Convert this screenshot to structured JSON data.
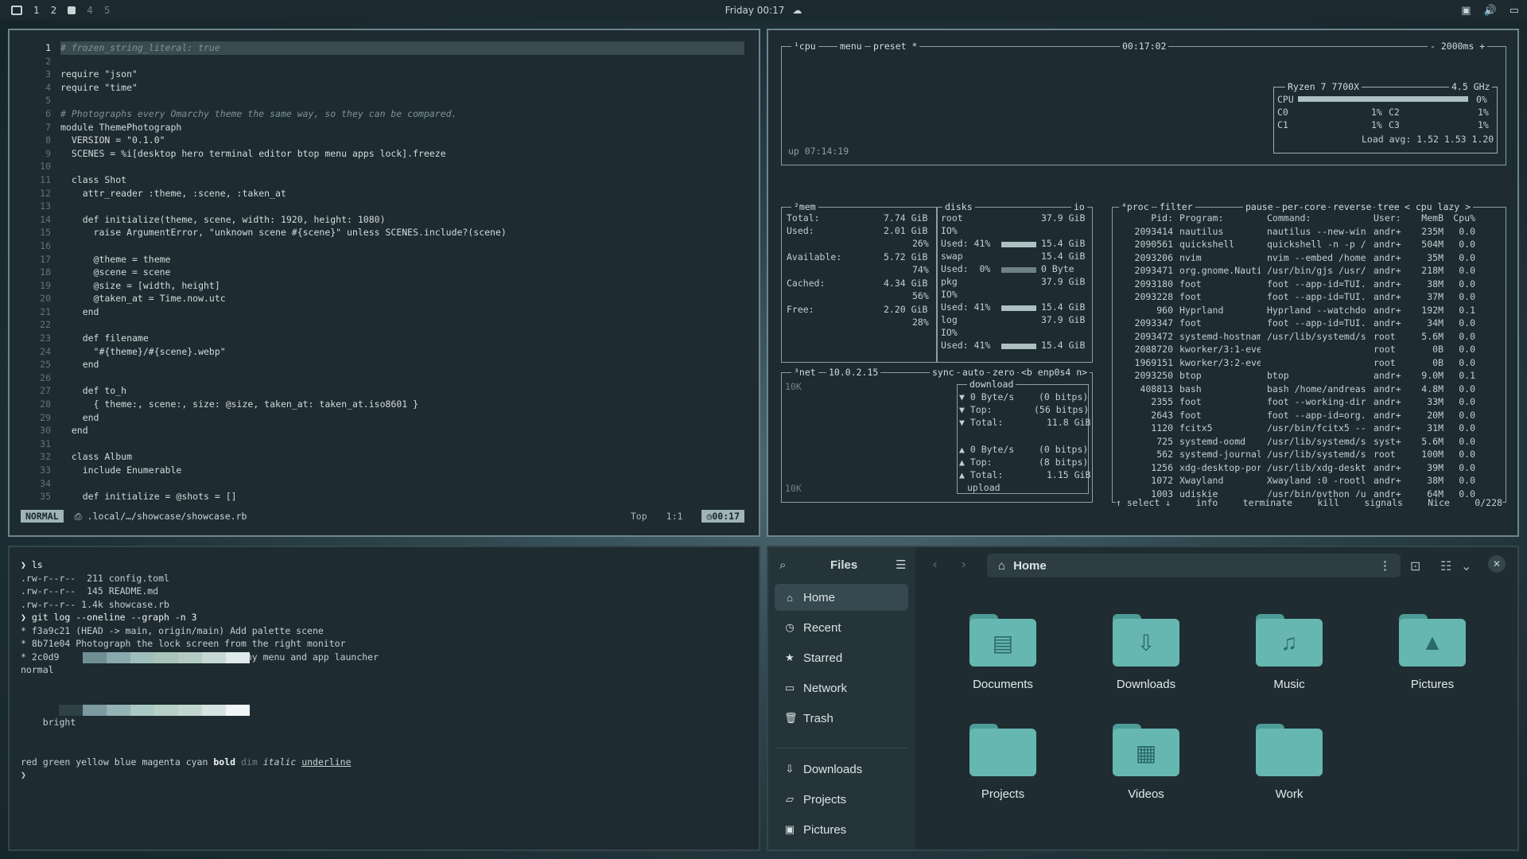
{
  "topbar": {
    "workspaces": [
      "1",
      "2",
      "3",
      "4",
      "5"
    ],
    "active_workspace": "3",
    "clock": "Friday 00:17"
  },
  "editor": {
    "line_numbers": [
      "1",
      "2",
      "3",
      "4",
      "5",
      "6",
      "7",
      "8",
      "9",
      "10",
      "11",
      "12",
      "13",
      "14",
      "15",
      "16",
      "17",
      "18",
      "19",
      "20",
      "21",
      "22",
      "23",
      "24",
      "25",
      "26",
      "27",
      "28",
      "29",
      "30",
      "31",
      "32",
      "33",
      "34",
      "35"
    ],
    "lines": [
      "# frozen_string_literal: true",
      "",
      "require \"json\"",
      "require \"time\"",
      "",
      "# Photographs every Omarchy theme the same way, so they can be compared.",
      "module ThemePhotograph",
      "  VERSION = \"0.1.0\"",
      "  SCENES = %i[desktop hero terminal editor btop menu apps lock].freeze",
      "",
      "  class Shot",
      "    attr_reader :theme, :scene, :taken_at",
      "",
      "    def initialize(theme, scene, width: 1920, height: 1080)",
      "      raise ArgumentError, \"unknown scene #{scene}\" unless SCENES.include?(scene)",
      "",
      "      @theme = theme",
      "      @scene = scene",
      "      @size = [width, height]",
      "      @taken_at = Time.now.utc",
      "    end",
      "",
      "    def filename",
      "      \"#{theme}/#{scene}.webp\"",
      "    end",
      "",
      "    def to_h",
      "      { theme:, scene:, size: @size, taken_at: taken_at.iso8601 }",
      "    end",
      "  end",
      "",
      "  class Album",
      "    include Enumerable",
      "",
      "    def initialize = @shots = []"
    ],
    "status": {
      "mode": "NORMAL",
      "path": ".local/…/showcase/showcase.rb",
      "scroll": "Top",
      "position": "1:1",
      "time": "00:17"
    }
  },
  "btop": {
    "cpu_box": {
      "title": "¹cpu",
      "menu": "menu",
      "preset": "preset *",
      "clock": "00:17:02",
      "refresh": "- 2000ms +",
      "uptime": "up 07:14:19",
      "cpu_name": "Ryzen 7 7700X",
      "freq": "4.5 GHz",
      "cpu_label": "CPU",
      "cpu_pct": "0%",
      "cores": [
        {
          "name": "C0",
          "pct": "1%"
        },
        {
          "name": "C2",
          "pct": "1%"
        },
        {
          "name": "C1",
          "pct": "1%"
        },
        {
          "name": "C3",
          "pct": "1%"
        }
      ],
      "load": "Load avg: 1.52 1.53 1.20"
    },
    "mem_box": {
      "title": "²mem",
      "total_label": "Total:",
      "total": "7.74 GiB",
      "used_label": "Used:",
      "used": "2.01 GiB",
      "used_pct": "26%",
      "avail_label": "Available:",
      "avail": "5.72 GiB",
      "avail_pct": "74%",
      "cached_label": "Cached:",
      "cached": "4.34 GiB",
      "cached_pct": "56%",
      "free_label": "Free:",
      "free": "2.20 GiB",
      "free_pct": "28%"
    },
    "disks_box": {
      "title": "disks",
      "io": "io",
      "disks": [
        {
          "name": "root",
          "size": "37.9 GiB",
          "io": "IO%",
          "used_label": "Used: 41%",
          "used": "15.4 GiB"
        },
        {
          "name": "swap",
          "size": "15.4 GiB",
          "io": "",
          "used_label": "Used:  0%",
          "used": "0 Byte"
        },
        {
          "name": "pkg",
          "size": "37.9 GiB",
          "io": "IO%",
          "used_label": "Used: 41%",
          "used": "15.4 GiB"
        },
        {
          "name": "log",
          "size": "37.9 GiB",
          "io": "IO%",
          "used_label": "Used: 41%",
          "used": "15.4 GiB"
        }
      ]
    },
    "net_box": {
      "title": "³net",
      "ip": "10.0.2.15",
      "sync": "sync",
      "auto": "auto",
      "zero": "zero",
      "iface": "<b enp0s4 n>",
      "scale_top": "10K",
      "scale_bottom": "10K",
      "download": "download",
      "upload": "upload",
      "dl_rate": "0 Byte/s",
      "dl_bits": "(0 bitps)",
      "dl_top_label": "Top:",
      "dl_top": "(56 bitps)",
      "dl_total_label": "Total:",
      "dl_total": "11.8 GiB",
      "ul_rate": "0 Byte/s",
      "ul_bits": "(0 bitps)",
      "ul_top_label": "Top:",
      "ul_top": "(8 bitps)",
      "ul_total_label": "Total:",
      "ul_total": "1.15 GiB"
    },
    "proc_box": {
      "title": "⁴proc",
      "filter": "filter",
      "pause": "pause",
      "per_core": "per-core",
      "reverse": "reverse",
      "tree": "tree",
      "sort": "< cpu lazy >",
      "headers": [
        "Pid:",
        "Program:",
        "Command:",
        "User:",
        "MemB",
        "Cpu%"
      ],
      "rows": [
        [
          "2093414",
          "nautilus",
          "nautilus --new-win",
          "andr+",
          "235M",
          "0.0"
        ],
        [
          "2090561",
          "quickshell",
          "quickshell -n -p /",
          "andr+",
          "504M",
          "0.0"
        ],
        [
          "2093206",
          "nvim",
          "nvim --embed /home",
          "andr+",
          "35M",
          "0.0"
        ],
        [
          "2093471",
          "org.gnome.Nauti",
          "/usr/bin/gjs /usr/",
          "andr+",
          "218M",
          "0.0"
        ],
        [
          "2093180",
          "foot",
          "foot --app-id=TUI.",
          "andr+",
          "38M",
          "0.0"
        ],
        [
          "2093228",
          "foot",
          "foot --app-id=TUI.",
          "andr+",
          "37M",
          "0.0"
        ],
        [
          "960",
          "Hyprland",
          "Hyprland --watchdo",
          "andr+",
          "192M",
          "0.1"
        ],
        [
          "2093347",
          "foot",
          "foot --app-id=TUI.",
          "andr+",
          "34M",
          "0.0"
        ],
        [
          "2093472",
          "systemd-hostnam",
          "/usr/lib/systemd/s",
          "root",
          "5.6M",
          "0.0"
        ],
        [
          "2088720",
          "kworker/3:1-even",
          "",
          "root",
          "0B",
          "0.0"
        ],
        [
          "1969151",
          "kworker/3:2-even",
          "",
          "root",
          "0B",
          "0.0"
        ],
        [
          "2093250",
          "btop",
          "btop",
          "andr+",
          "9.0M",
          "0.1"
        ],
        [
          "408813",
          "bash",
          "bash /home/andreas",
          "andr+",
          "4.8M",
          "0.0"
        ],
        [
          "2355",
          "foot",
          "foot --working-dir",
          "andr+",
          "33M",
          "0.0"
        ],
        [
          "2643",
          "foot",
          "foot --app-id=org.",
          "andr+",
          "20M",
          "0.0"
        ],
        [
          "1120",
          "fcitx5",
          "/usr/bin/fcitx5 --",
          "andr+",
          "31M",
          "0.0"
        ],
        [
          "725",
          "systemd-oomd",
          "/usr/lib/systemd/s",
          "syst+",
          "5.6M",
          "0.0"
        ],
        [
          "562",
          "systemd-journal",
          "/usr/lib/systemd/s",
          "root",
          "100M",
          "0.0"
        ],
        [
          "1256",
          "xdg-desktop-por",
          "/usr/lib/xdg-deskt",
          "andr+",
          "39M",
          "0.0"
        ],
        [
          "1072",
          "Xwayland",
          "Xwayland :0 -rootl",
          "andr+",
          "38M",
          "0.0"
        ],
        [
          "1003",
          "udiskie",
          "/usr/bin/python /u",
          "andr+",
          "64M",
          "0.0"
        ]
      ],
      "footer": [
        "↑ select ↓",
        "info",
        "terminate",
        "kill",
        "signals",
        "Nice"
      ],
      "count": "0/228"
    }
  },
  "terminal": {
    "lines": [
      "❯ ls",
      ".rw-r--r--  211 config.toml",
      ".rw-r--r--  145 README.md",
      ".rw-r--r-- 1.4k showcase.rb",
      "❯ git log --oneline --graph -n 3",
      "* f3a9c21 (HEAD -> main, origin/main) Add palette scene",
      "* 8b71e04 Photograph the lock screen from the right monitor",
      "* 2c0d9aa (tag: v0.1.0) Capture the Omarchy menu and app launcher"
    ],
    "normal_label": "normal",
    "bright_label": "bright",
    "normal_colors": [
      "#1e2b30",
      "#6f8e94",
      "#88a9ad",
      "#9fbfbd",
      "#a8c4b8",
      "#b4cbc3",
      "#c6d7d4",
      "#dfe9e9"
    ],
    "bright_colors": [
      "#2f4147",
      "#7c9aa0",
      "#94b3b6",
      "#aac8c4",
      "#b6d0c6",
      "#c2d6d0",
      "#d5e3e1",
      "#f0f5f5"
    ],
    "styles_text": "red green yellow blue magenta cyan",
    "bold": "bold",
    "dim": "dim",
    "italic": "italic",
    "underline": "underline",
    "prompt": "❯"
  },
  "files": {
    "title": "Files",
    "location": "Home",
    "sidebar": [
      {
        "icon": "⌂",
        "label": "Home"
      },
      {
        "icon": "◷",
        "label": "Recent"
      },
      {
        "icon": "★",
        "label": "Starred"
      },
      {
        "icon": "▭",
        "label": "Network"
      },
      {
        "icon": "🗑",
        "label": "Trash"
      },
      {
        "icon": "⇩",
        "label": "Downloads"
      },
      {
        "icon": "▱",
        "label": "Projects"
      },
      {
        "icon": "▣",
        "label": "Pictures"
      }
    ],
    "folders": [
      {
        "label": "Documents",
        "glyph": "▤"
      },
      {
        "label": "Downloads",
        "glyph": "⇩"
      },
      {
        "label": "Music",
        "glyph": "♫"
      },
      {
        "label": "Pictures",
        "glyph": "▲"
      },
      {
        "label": "Projects",
        "glyph": ""
      },
      {
        "label": "Videos",
        "glyph": "▦"
      },
      {
        "label": "Work",
        "glyph": ""
      }
    ]
  }
}
